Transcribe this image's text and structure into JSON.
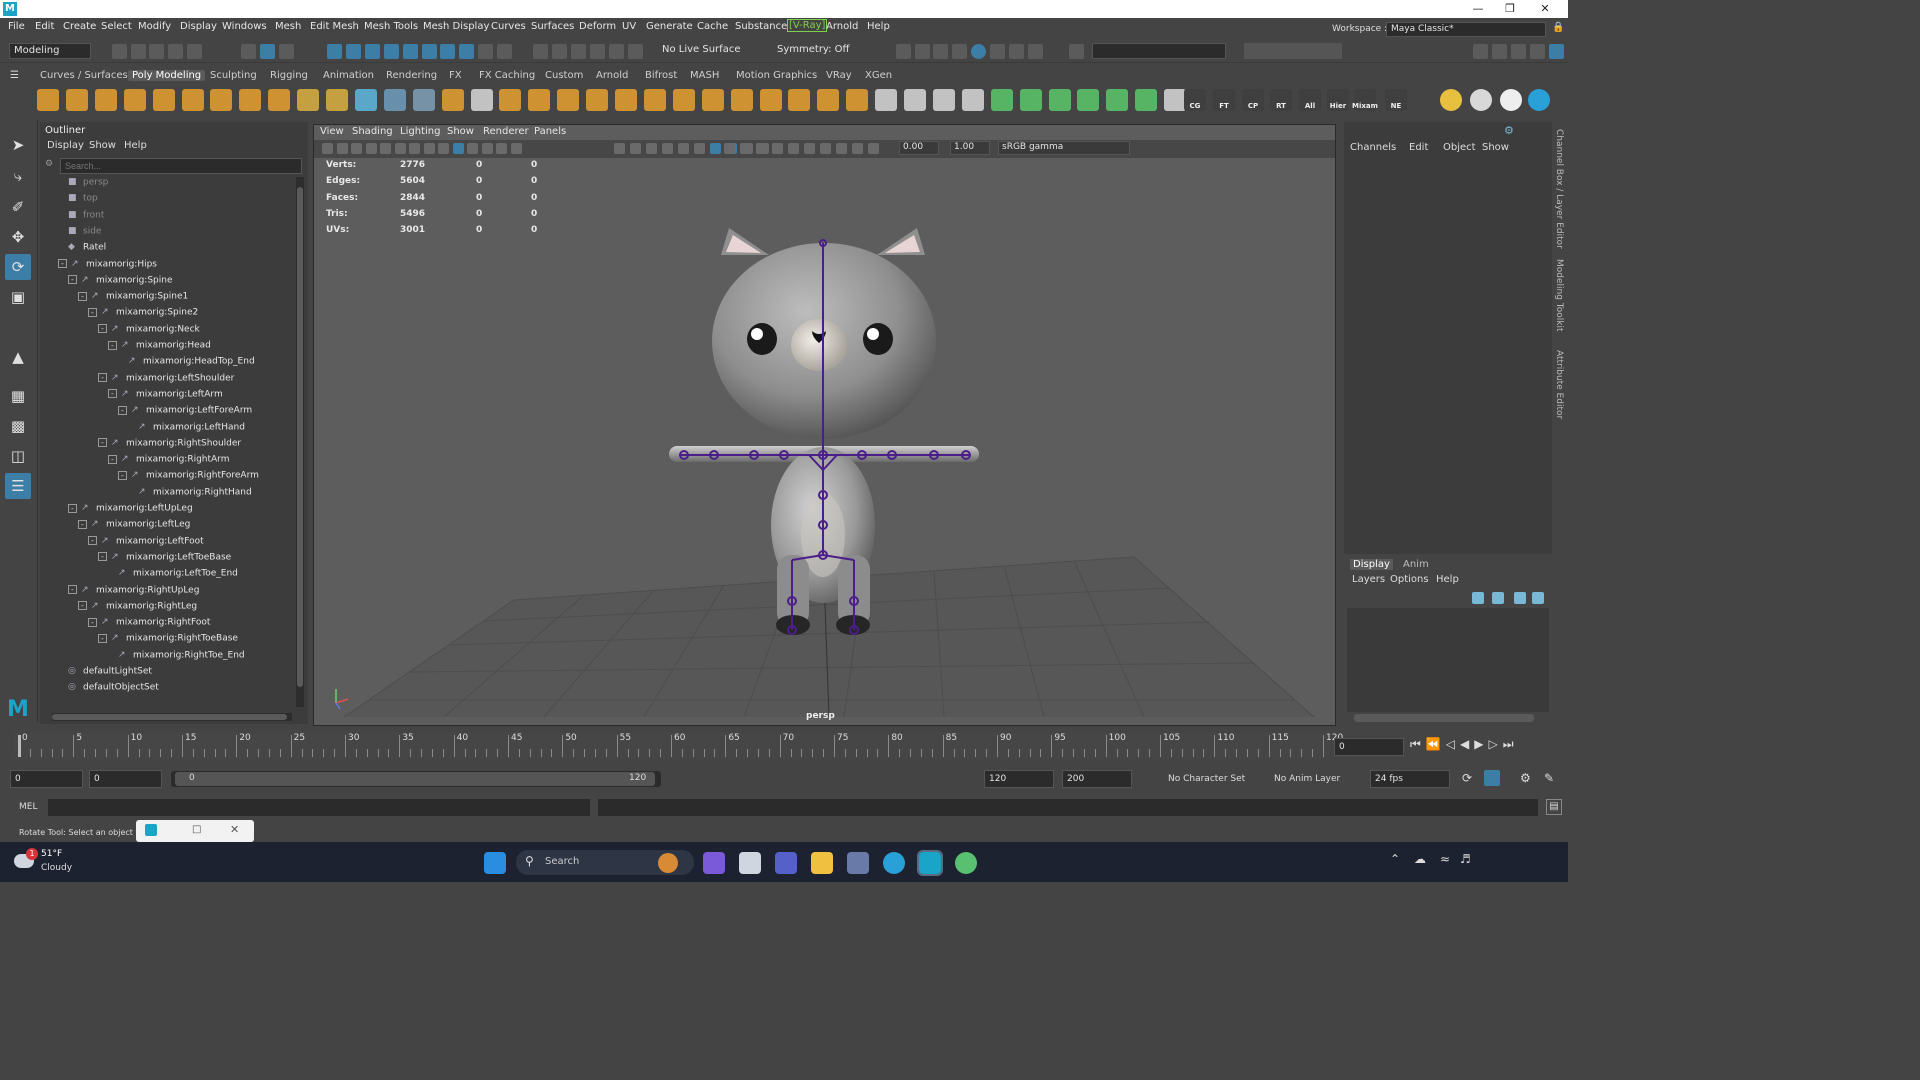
{
  "menubar": {
    "items": [
      "File",
      "Edit",
      "Create",
      "Select",
      "Modify",
      "Display",
      "Windows",
      "Mesh",
      "Edit Mesh",
      "Mesh Tools",
      "Mesh Display",
      "Curves",
      "Surfaces",
      "Deform",
      "UV",
      "Generate",
      "Cache",
      "Substance",
      "[V-Ray]",
      "Arnold",
      "Help"
    ],
    "workspace_label": "Workspace :",
    "workspace_value": "Maya Classic*"
  },
  "statusline": {
    "mode": "Modeling",
    "live_surface": "No Live Surface",
    "symmetry": "Symmetry: Off"
  },
  "shelf": {
    "tabs": [
      "Curves / Surfaces",
      "Poly Modeling",
      "Sculpting",
      "Rigging",
      "Animation",
      "Rendering",
      "FX",
      "FX Caching",
      "Custom",
      "Arnold",
      "Bifrost",
      "MASH",
      "Motion Graphics",
      "VRay",
      "XGen"
    ],
    "active_tab": "Poly Modeling",
    "icon_labels": [
      "CG",
      "FT",
      "CP",
      "RT",
      "All",
      "Hier",
      "Mixam",
      "NE"
    ]
  },
  "outliner": {
    "title": "Outliner",
    "menu": [
      "Display",
      "Show",
      "Help"
    ],
    "search_placeholder": "Search...",
    "items": [
      {
        "label": "persp",
        "depth": 0,
        "icon": "camera-icon",
        "dim": true,
        "exp": ""
      },
      {
        "label": "top",
        "depth": 0,
        "icon": "camera-icon",
        "dim": true,
        "exp": ""
      },
      {
        "label": "front",
        "depth": 0,
        "icon": "camera-icon",
        "dim": true,
        "exp": ""
      },
      {
        "label": "side",
        "depth": 0,
        "icon": "camera-icon",
        "dim": true,
        "exp": ""
      },
      {
        "label": "Ratel",
        "depth": 0,
        "icon": "mesh-icon",
        "dim": false,
        "exp": ""
      },
      {
        "label": "mixamorig:Hips",
        "depth": 0,
        "icon": "joint-icon",
        "dim": false,
        "exp": "-"
      },
      {
        "label": "mixamorig:Spine",
        "depth": 1,
        "icon": "joint-icon",
        "dim": false,
        "exp": "-"
      },
      {
        "label": "mixamorig:Spine1",
        "depth": 2,
        "icon": "joint-icon",
        "dim": false,
        "exp": "-"
      },
      {
        "label": "mixamorig:Spine2",
        "depth": 3,
        "icon": "joint-icon",
        "dim": false,
        "exp": "-"
      },
      {
        "label": "mixamorig:Neck",
        "depth": 4,
        "icon": "joint-icon",
        "dim": false,
        "exp": "-"
      },
      {
        "label": "mixamorig:Head",
        "depth": 5,
        "icon": "joint-icon",
        "dim": false,
        "exp": "-"
      },
      {
        "label": "mixamorig:HeadTop_End",
        "depth": 6,
        "icon": "joint-icon",
        "dim": false,
        "exp": ""
      },
      {
        "label": "mixamorig:LeftShoulder",
        "depth": 4,
        "icon": "joint-icon",
        "dim": false,
        "exp": "-"
      },
      {
        "label": "mixamorig:LeftArm",
        "depth": 5,
        "icon": "joint-icon",
        "dim": false,
        "exp": "-"
      },
      {
        "label": "mixamorig:LeftForeArm",
        "depth": 6,
        "icon": "joint-icon",
        "dim": false,
        "exp": "-"
      },
      {
        "label": "mixamorig:LeftHand",
        "depth": 7,
        "icon": "joint-icon",
        "dim": false,
        "exp": ""
      },
      {
        "label": "mixamorig:RightShoulder",
        "depth": 4,
        "icon": "joint-icon",
        "dim": false,
        "exp": "-"
      },
      {
        "label": "mixamorig:RightArm",
        "depth": 5,
        "icon": "joint-icon",
        "dim": false,
        "exp": "-"
      },
      {
        "label": "mixamorig:RightForeArm",
        "depth": 6,
        "icon": "joint-icon",
        "dim": false,
        "exp": "-"
      },
      {
        "label": "mixamorig:RightHand",
        "depth": 7,
        "icon": "joint-icon",
        "dim": false,
        "exp": ""
      },
      {
        "label": "mixamorig:LeftUpLeg",
        "depth": 1,
        "icon": "joint-icon",
        "dim": false,
        "exp": "-"
      },
      {
        "label": "mixamorig:LeftLeg",
        "depth": 2,
        "icon": "joint-icon",
        "dim": false,
        "exp": "-"
      },
      {
        "label": "mixamorig:LeftFoot",
        "depth": 3,
        "icon": "joint-icon",
        "dim": false,
        "exp": "-"
      },
      {
        "label": "mixamorig:LeftToeBase",
        "depth": 4,
        "icon": "joint-icon",
        "dim": false,
        "exp": "-"
      },
      {
        "label": "mixamorig:LeftToe_End",
        "depth": 5,
        "icon": "joint-icon",
        "dim": false,
        "exp": ""
      },
      {
        "label": "mixamorig:RightUpLeg",
        "depth": 1,
        "icon": "joint-icon",
        "dim": false,
        "exp": "-"
      },
      {
        "label": "mixamorig:RightLeg",
        "depth": 2,
        "icon": "joint-icon",
        "dim": false,
        "exp": "-"
      },
      {
        "label": "mixamorig:RightFoot",
        "depth": 3,
        "icon": "joint-icon",
        "dim": false,
        "exp": "-"
      },
      {
        "label": "mixamorig:RightToeBase",
        "depth": 4,
        "icon": "joint-icon",
        "dim": false,
        "exp": "-"
      },
      {
        "label": "mixamorig:RightToe_End",
        "depth": 5,
        "icon": "joint-icon",
        "dim": false,
        "exp": ""
      },
      {
        "label": "defaultLightSet",
        "depth": 0,
        "icon": "set-icon",
        "dim": false,
        "exp": ""
      },
      {
        "label": "defaultObjectSet",
        "depth": 0,
        "icon": "set-icon",
        "dim": false,
        "exp": ""
      }
    ]
  },
  "viewport": {
    "menu": [
      "View",
      "Shading",
      "Lighting",
      "Show",
      "Renderer",
      "Panels"
    ],
    "exposure": "0.00",
    "gamma": "1.00",
    "color_space": "sRGB gamma",
    "camera_label": "persp",
    "stats": [
      {
        "label": "Verts:",
        "a": "2776",
        "b": "0",
        "c": "0"
      },
      {
        "label": "Edges:",
        "a": "5604",
        "b": "0",
        "c": "0"
      },
      {
        "label": "Faces:",
        "a": "2844",
        "b": "0",
        "c": "0"
      },
      {
        "label": "Tris:",
        "a": "5496",
        "b": "0",
        "c": "0"
      },
      {
        "label": "UVs:",
        "a": "3001",
        "b": "0",
        "c": "0"
      }
    ]
  },
  "channelbox": {
    "menu": [
      "Channels",
      "Edit",
      "Object",
      "Show"
    ]
  },
  "layereditor": {
    "tabs": [
      "Display",
      "Anim"
    ],
    "menu": [
      "Layers",
      "Options",
      "Help"
    ]
  },
  "sidetabs": [
    "Channel Box / Layer Editor",
    "Modeling Toolkit",
    "Attribute Editor"
  ],
  "timeslider": {
    "ticks": [
      "0",
      "5",
      "10",
      "15",
      "20",
      "25",
      "30",
      "35",
      "40",
      "45",
      "50",
      "55",
      "60",
      "65",
      "70",
      "75",
      "80",
      "85",
      "90",
      "95",
      "100",
      "105",
      "110",
      "115",
      "120"
    ],
    "current_frame": "0"
  },
  "range": {
    "start": "0",
    "anim_start": "0",
    "range_start_inner": "0",
    "range_end_inner": "120",
    "end": "120",
    "anim_end": "200",
    "character_set": "No Character Set",
    "anim_layer": "No Anim Layer",
    "fps": "24 fps"
  },
  "cmdline": {
    "label": "MEL"
  },
  "helpline": {
    "text": "Rotate Tool: Select an object to r"
  },
  "taskbar": {
    "weather_temp": "51°F",
    "weather_cond": "Cloudy",
    "weather_badge": "1",
    "search_placeholder": "Search"
  },
  "colors": {
    "accent": "#3d7ea6",
    "vray": "#7fd04d",
    "skeleton": "#4b1e8a"
  }
}
